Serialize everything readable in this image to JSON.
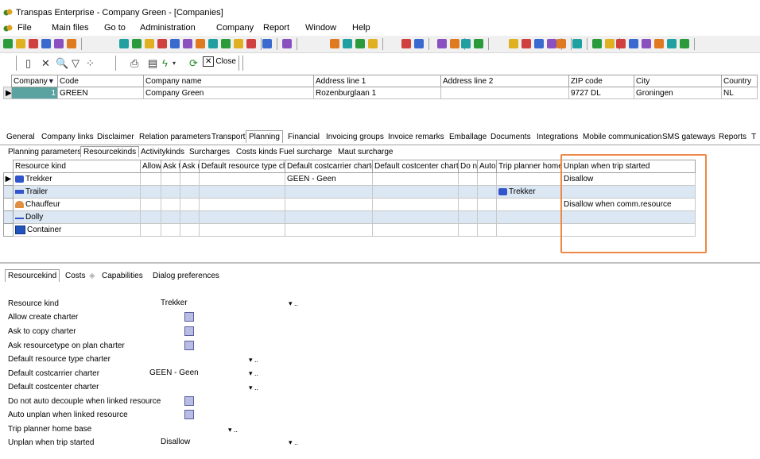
{
  "window": {
    "title": "Transpas Enterprise - Company Green - [Companies]"
  },
  "menu": [
    "File",
    "Main files",
    "Go to",
    "Administration",
    "Company",
    "Report",
    "Window",
    "Help"
  ],
  "toolbar": {
    "close_label": "Close"
  },
  "companies": {
    "headers": [
      "Company",
      "Code",
      "Company name",
      "Address line 1",
      "Address line 2",
      "ZIP code",
      "City",
      "Country"
    ],
    "row": {
      "company": "1",
      "code": "GREEN",
      "name": "Company Green",
      "address1": "Rozenburglaan 1",
      "address2": "",
      "zip": "9727 DL",
      "city": "Groningen",
      "country": "NL"
    }
  },
  "main_tabs": [
    "General",
    "Company links",
    "Disclaimer",
    "Relation parameters",
    "Transport",
    "Planning",
    "Financial",
    "Invoicing groups",
    "Invoice remarks",
    "Emballage",
    "Documents",
    "Integrations",
    "Mobile communication",
    "SMS gateways",
    "Reports",
    "T"
  ],
  "sub_tabs": [
    "Planning parameters",
    "Resourcekinds",
    "Activitykinds",
    "Surcharges",
    "Costs kinds",
    "Fuel surcharge",
    "Maut surcharge"
  ],
  "resource_grid": {
    "headers": [
      "Resource kind",
      "Allow",
      "Ask t",
      "Ask r",
      "Default resource type cha",
      "Default costcarrier charter",
      "Default costcenter charte",
      "Do n",
      "Auto",
      "Trip planner home b",
      "Unplan when trip started"
    ],
    "rows": [
      {
        "kind": "Trekker",
        "costcarrier": "GEEN - Geen",
        "home": "",
        "unplan": "Disallow"
      },
      {
        "kind": "Trailer",
        "costcarrier": "",
        "home": "Trekker",
        "unplan": ""
      },
      {
        "kind": "Chauffeur",
        "costcarrier": "",
        "home": "",
        "unplan": "Disallow when comm.resource"
      },
      {
        "kind": "Dolly",
        "costcarrier": "",
        "home": "",
        "unplan": ""
      },
      {
        "kind": "Container",
        "costcarrier": "",
        "home": "",
        "unplan": ""
      }
    ]
  },
  "detail_tabs": [
    "Resourcekind",
    "Costs",
    "Capabilities",
    "Dialog preferences"
  ],
  "form": {
    "resource_kind_label": "Resource kind",
    "resource_kind_value": "Trekker",
    "allow_create_label": "Allow create charter",
    "ask_copy_label": "Ask to copy charter",
    "ask_type_label": "Ask resourcetype on plan charter",
    "def_type_label": "Default resource type charter",
    "def_costcarrier_label": "Default costcarrier charter",
    "def_costcarrier_value": "GEEN - Geen",
    "def_costcenter_label": "Default costcenter charter",
    "no_decouple_label": "Do not auto decouple when linked resource",
    "auto_unplan_label": "Auto unplan when linked resource",
    "home_base_label": "Trip planner home base",
    "unplan_label": "Unplan when trip started",
    "unplan_value": "Disallow"
  },
  "colors": {
    "accent_highlight": "#ee8844",
    "selected_cell": "#5ba3a0",
    "alt_row": "#dbe7f3"
  }
}
